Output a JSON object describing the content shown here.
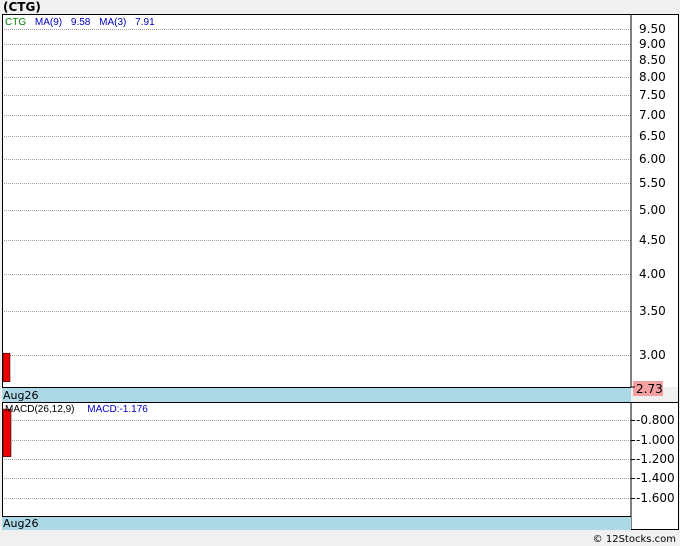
{
  "title": "(CTG)",
  "footer": "© 12Stocks.com",
  "colors": {
    "grid": "#a0a0a0",
    "border": "#000000",
    "bar": "#ee0000",
    "date_strip": "#add8e6",
    "price_badge": "#f5a0a0",
    "ticker": "#008000",
    "ma": "#0000c0",
    "macd_label": "#000000",
    "macd_value": "#0000c0"
  },
  "price_panel": {
    "legend": {
      "ticker": "CTG",
      "ma9_label": "MA(9)",
      "ma9_value": "9.58",
      "ma3_label": "MA(3)",
      "ma3_value": "7.91"
    },
    "date_label": "Aug26",
    "last_price_label": "2.73",
    "tick_labels": [
      "9.50",
      "9.00",
      "8.50",
      "8.00",
      "7.50",
      "7.00",
      "6.50",
      "6.00",
      "5.50",
      "5.00",
      "4.50",
      "4.00",
      "3.50",
      "3.00"
    ]
  },
  "macd_panel": {
    "legend": {
      "label": "MACD(26,12,9)",
      "value": "MACD:-1.176"
    },
    "date_label": "Aug26",
    "tick_labels": [
      "-0.800",
      "-1.000",
      "-1.200",
      "-1.400",
      "-1.600"
    ]
  },
  "chart_data": [
    {
      "type": "bar",
      "title": "(CTG)",
      "categories": [
        "Aug26"
      ],
      "series": [
        {
          "name": "CTG",
          "values": [
            {
              "open": 3.02,
              "close": 2.73
            }
          ]
        }
      ],
      "annotations": {
        "MA(9)": 9.58,
        "MA(3)": 7.91,
        "last": 2.73
      },
      "y_axis": "log",
      "ylim": [
        2.68,
        10.0
      ],
      "yticks": [
        9.5,
        9.0,
        8.5,
        8.0,
        7.5,
        7.0,
        6.5,
        6.0,
        5.5,
        5.0,
        4.5,
        4.0,
        3.5,
        3.0
      ],
      "grid": true
    },
    {
      "type": "bar",
      "title": "MACD(26,12,9)",
      "categories": [
        "Aug26"
      ],
      "series": [
        {
          "name": "MACD",
          "values": [
            -1.176
          ]
        }
      ],
      "top_of_bar": -0.683,
      "ylim": [
        -1.79,
        -0.62
      ],
      "yticks": [
        -0.8,
        -1.0,
        -1.2,
        -1.4,
        -1.6
      ],
      "grid": true
    }
  ]
}
